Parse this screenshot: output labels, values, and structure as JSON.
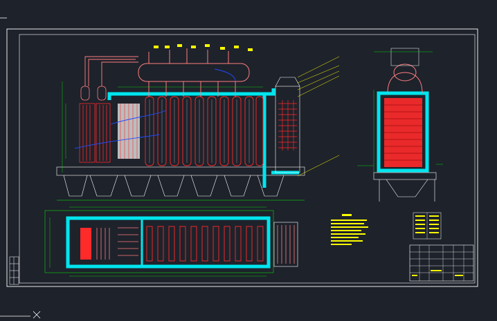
{
  "drawing": {
    "colors": {
      "background": "#1e222b",
      "frame": "#ffffff",
      "outline": "#00ff00",
      "insulation": "#00e5ee",
      "tubes": "#ff2a2a",
      "pipes": "#ff7f7f",
      "annotation": "#ffff00",
      "flow": "#1e4cff"
    },
    "views": [
      {
        "id": "front-elevation"
      },
      {
        "id": "side-elevation"
      },
      {
        "id": "plan-section"
      }
    ],
    "notes_block": {
      "id": "technical-notes"
    },
    "legend_table": {
      "id": "parts-legend"
    },
    "title_block": {
      "id": "title-block"
    }
  }
}
